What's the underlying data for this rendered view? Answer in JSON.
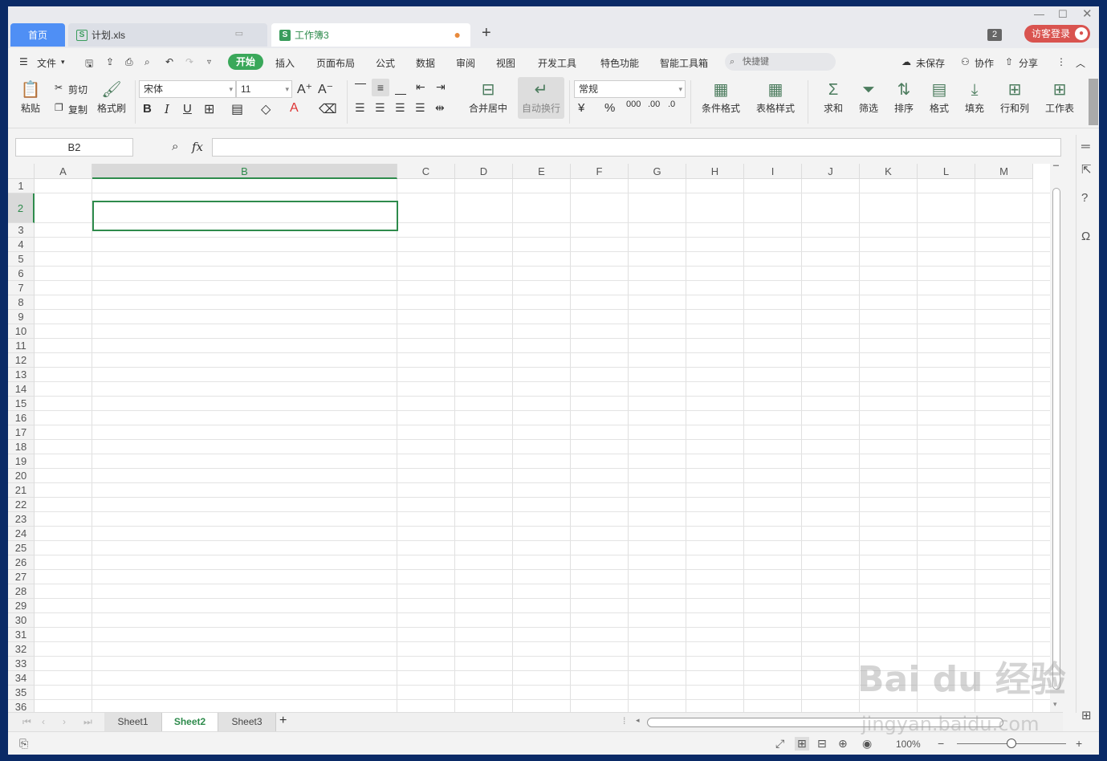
{
  "tabs": {
    "home": "首页",
    "file": "计划.xls",
    "book": "工作簿3",
    "add": "+"
  },
  "titlebar": {
    "badge": "2",
    "login": "访客登录"
  },
  "menu": {
    "file": "文件",
    "items": [
      "开始",
      "插入",
      "页面布局",
      "公式",
      "数据",
      "审阅",
      "视图",
      "开发工具",
      "特色功能",
      "智能工具箱"
    ],
    "search_placeholder": "快捷键",
    "unsaved": "未保存",
    "collab": "协作",
    "share": "分享"
  },
  "ribbon": {
    "paste": "粘贴",
    "cut": "剪切",
    "copy": "复制",
    "format_painter": "格式刷",
    "font_name": "宋体",
    "font_size": "11",
    "merge_center": "合并居中",
    "auto_wrap": "自动换行",
    "number_format": "常规",
    "cond_format": "条件格式",
    "table_style": "表格样式",
    "sum": "求和",
    "filter": "筛选",
    "sort": "排序",
    "format": "格式",
    "fill": "填充",
    "rows_cols": "行和列",
    "worksheet": "工作表"
  },
  "formula": {
    "name_box": "B2",
    "fx": "fx",
    "value": ""
  },
  "columns": [
    "A",
    "B",
    "C",
    "D",
    "E",
    "F",
    "G",
    "H",
    "I",
    "J",
    "K",
    "L",
    "M"
  ],
  "rows": [
    "1",
    "2",
    "3",
    "4",
    "5",
    "6",
    "7",
    "8",
    "9",
    "10",
    "11",
    "12",
    "13",
    "14",
    "15",
    "16",
    "17",
    "18",
    "19",
    "20",
    "21",
    "22",
    "23",
    "24",
    "25",
    "26",
    "27",
    "28",
    "29",
    "30",
    "31",
    "32",
    "33",
    "34",
    "35",
    "36"
  ],
  "selected_cell": "B2",
  "sheets": [
    "Sheet1",
    "Sheet2",
    "Sheet3"
  ],
  "active_sheet": "Sheet2",
  "status": {
    "zoom": "100%"
  },
  "watermark": {
    "logo": "Bai du 经验",
    "url": "jingyan.baidu.com"
  },
  "colors": {
    "accent": "#3aa85a",
    "home_tab": "#4f8ff5",
    "login": "#d9534f",
    "selection": "#2e8b4c"
  }
}
